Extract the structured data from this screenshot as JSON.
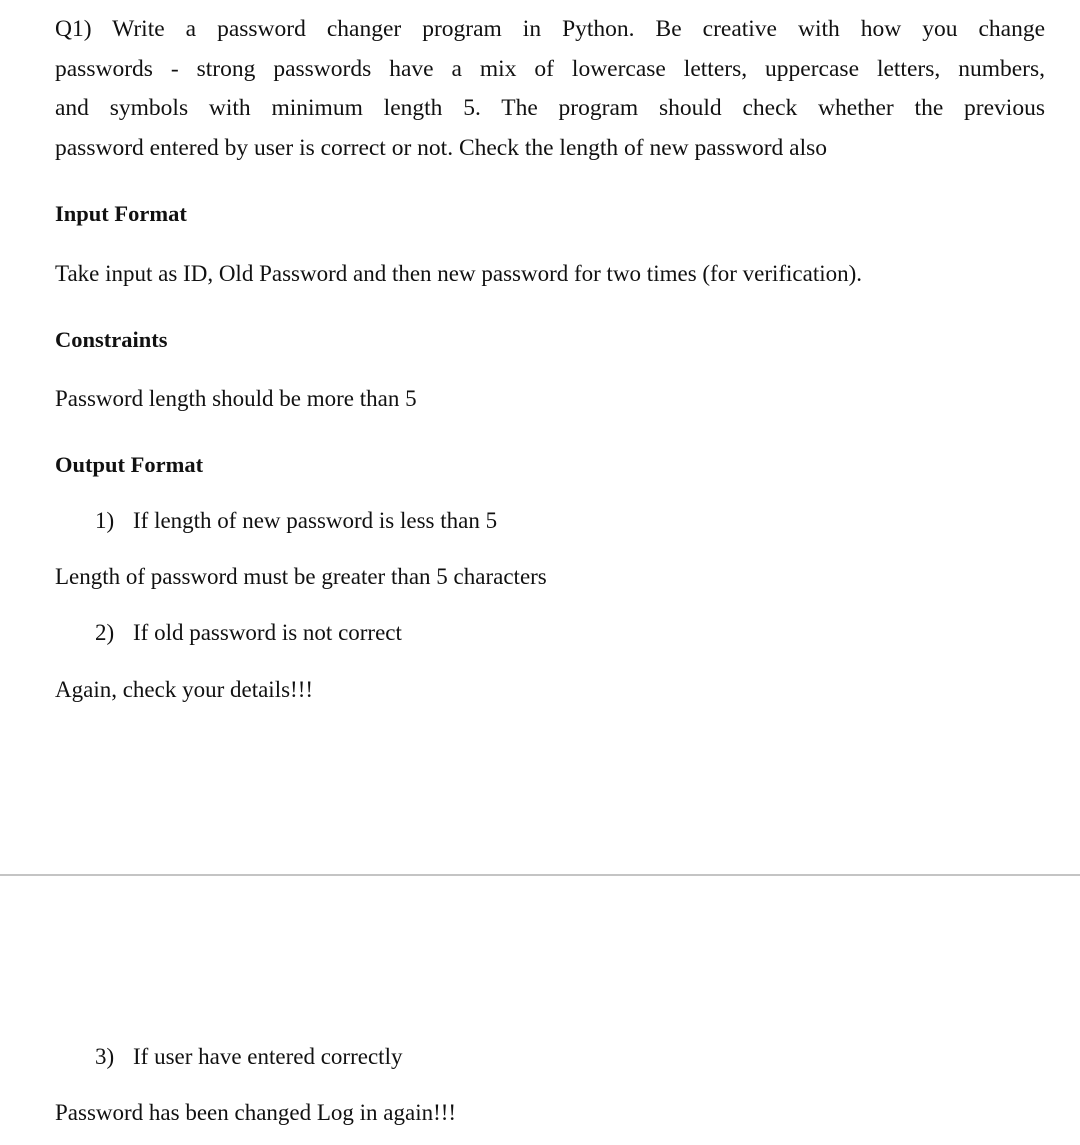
{
  "question": {
    "lines": [
      "Q1) Write a password changer program in Python. Be creative with how you change",
      "passwords - strong passwords have a mix of lowercase letters, uppercase letters, numbers,",
      "and symbols with minimum length 5. The program should check whether the previous",
      "password entered by user is correct or not. Check the length of new password also"
    ]
  },
  "input_format": {
    "heading": "Input Format",
    "text": "Take input as ID, Old Password and then new password for two times (for verification)."
  },
  "constraints": {
    "heading": "Constraints",
    "text": "Password length should be more than 5"
  },
  "output_format": {
    "heading": "Output Format",
    "cases": [
      {
        "number": "1)",
        "condition": "If length of new password is less than 5",
        "output": "Length of password must be greater than 5 characters"
      },
      {
        "number": "2)",
        "condition": "If old password is not correct",
        "output": "Again, check your details!!!"
      },
      {
        "number": "3)",
        "condition": "If user have entered correctly",
        "output": "Password has been changed Log in again!!!"
      }
    ]
  }
}
